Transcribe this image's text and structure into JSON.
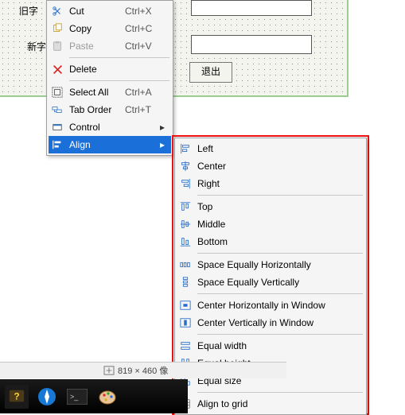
{
  "design_surface": {
    "label1": "旧字",
    "label2": "新字",
    "exit_button": "退出"
  },
  "context_menu": {
    "cut": {
      "label": "Cut",
      "accel": "Ctrl+X"
    },
    "copy": {
      "label": "Copy",
      "accel": "Ctrl+C"
    },
    "paste": {
      "label": "Paste",
      "accel": "Ctrl+V"
    },
    "delete": {
      "label": "Delete",
      "accel": ""
    },
    "select_all": {
      "label": "Select All",
      "accel": "Ctrl+A"
    },
    "tab_order": {
      "label": "Tab Order",
      "accel": "Ctrl+T"
    },
    "control": {
      "label": "Control",
      "accel": ""
    },
    "align": {
      "label": "Align",
      "accel": ""
    }
  },
  "align_submenu": {
    "left": "Left",
    "center": "Center",
    "right": "Right",
    "top": "Top",
    "middle": "Middle",
    "bottom": "Bottom",
    "space_h": "Space Equally Horizontally",
    "space_v": "Space Equally Vertically",
    "cent_h_win": "Center Horizontally in Window",
    "cent_v_win": "Center Vertically in Window",
    "eq_w": "Equal width",
    "eq_h": "Equal height",
    "eq_s": "Equal size",
    "grid": "Align to grid"
  },
  "statusbar": {
    "dims": "819 × 460"
  },
  "glyphs": {
    "status_px_suffix": "像"
  }
}
